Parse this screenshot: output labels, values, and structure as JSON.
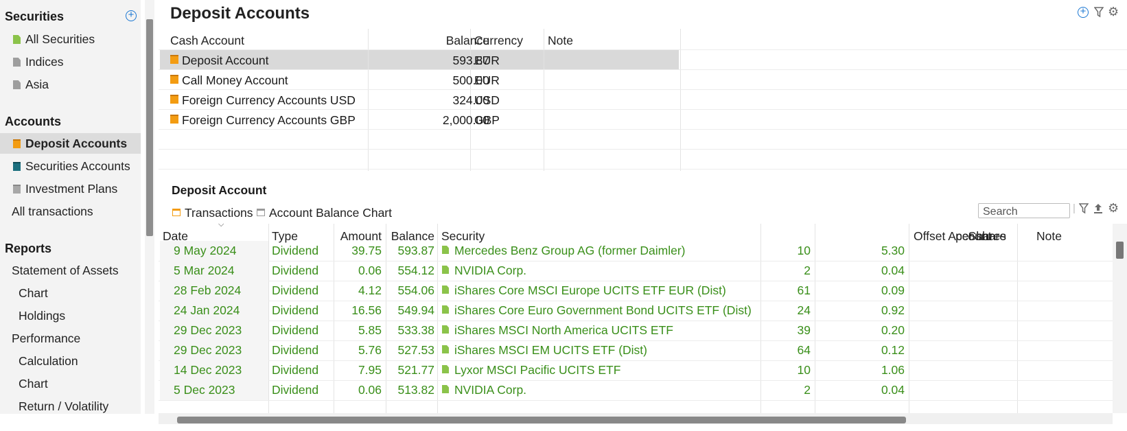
{
  "sidebar": {
    "sections": [
      {
        "title": "Securities",
        "items": [
          {
            "label": "All Securities",
            "icon": "document-green-icon"
          },
          {
            "label": "Indices",
            "icon": "document-grey-icon"
          },
          {
            "label": "Asia",
            "icon": "document-grey-icon"
          }
        ]
      },
      {
        "title": "Accounts",
        "items": [
          {
            "label": "Deposit Accounts",
            "icon": "deposit-account-icon",
            "selected": true
          },
          {
            "label": "Securities Accounts",
            "icon": "securities-account-icon"
          },
          {
            "label": "Investment Plans",
            "icon": "investment-plan-icon"
          },
          {
            "label": "All transactions"
          }
        ]
      },
      {
        "title": "Reports",
        "items": [
          {
            "label": "Statement of Assets"
          },
          {
            "label": "Chart"
          },
          {
            "label": "Holdings"
          },
          {
            "label": "Performance"
          },
          {
            "label": "Calculation"
          },
          {
            "label": "Chart"
          },
          {
            "label": "Return / Volatility"
          }
        ]
      }
    ]
  },
  "main": {
    "title": "Deposit Accounts",
    "columns": [
      "Cash Account",
      "Balance",
      "Currency",
      "Note"
    ],
    "accounts": [
      {
        "name": "Deposit Account",
        "balance": "593.87",
        "currency": "EUR",
        "note": "",
        "selected": true
      },
      {
        "name": "Call Money Account",
        "balance": "500.00",
        "currency": "EUR",
        "note": ""
      },
      {
        "name": "Foreign Currency Accounts USD",
        "balance": "324.00",
        "currency": "USD",
        "note": ""
      },
      {
        "name": "Foreign Currency Accounts GBP",
        "balance": "2,000.00",
        "currency": "GBP",
        "note": ""
      }
    ]
  },
  "detail": {
    "title": "Deposit Account",
    "tabs": [
      "Transactions",
      "Account Balance Chart"
    ],
    "search_placeholder": "Search",
    "columns": [
      "Date",
      "Type",
      "Amount",
      "Balance",
      "Security",
      "Shares",
      "per share",
      "Offset Account",
      "Note"
    ],
    "rows": [
      {
        "date": "9 May 2024",
        "type": "Dividend",
        "amount": "39.75",
        "balance": "593.87",
        "security": "Mercedes Benz Group AG (former Daimler)",
        "shares": "10",
        "per_share": "5.30"
      },
      {
        "date": "5 Mar 2024",
        "type": "Dividend",
        "amount": "0.06",
        "balance": "554.12",
        "security": "NVIDIA Corp.",
        "shares": "2",
        "per_share": "0.04"
      },
      {
        "date": "28 Feb 2024",
        "type": "Dividend",
        "amount": "4.12",
        "balance": "554.06",
        "security": "iShares Core MSCI Europe UCITS ETF EUR (Dist)",
        "shares": "61",
        "per_share": "0.09"
      },
      {
        "date": "24 Jan 2024",
        "type": "Dividend",
        "amount": "16.56",
        "balance": "549.94",
        "security": "iShares Core Euro Government Bond UCITS ETF (Dist)",
        "shares": "24",
        "per_share": "0.92"
      },
      {
        "date": "29 Dec 2023",
        "type": "Dividend",
        "amount": "5.85",
        "balance": "533.38",
        "security": "iShares MSCI North America UCITS ETF",
        "shares": "39",
        "per_share": "0.20"
      },
      {
        "date": "29 Dec 2023",
        "type": "Dividend",
        "amount": "5.76",
        "balance": "527.53",
        "security": "iShares MSCI EM UCITS ETF (Dist)",
        "shares": "64",
        "per_share": "0.12"
      },
      {
        "date": "14 Dec 2023",
        "type": "Dividend",
        "amount": "7.95",
        "balance": "521.77",
        "security": "Lyxor MSCI Pacific UCITS ETF",
        "shares": "10",
        "per_share": "1.06"
      },
      {
        "date": "5 Dec 2023",
        "type": "Dividend",
        "amount": "0.06",
        "balance": "513.82",
        "security": "NVIDIA Corp.",
        "shares": "2",
        "per_share": "0.04"
      }
    ],
    "text_color": "#3a8f1a"
  },
  "icons": {
    "add": "add-circle-icon",
    "filter": "filter-icon",
    "settings": "gear-icon",
    "export": "export-icon"
  }
}
